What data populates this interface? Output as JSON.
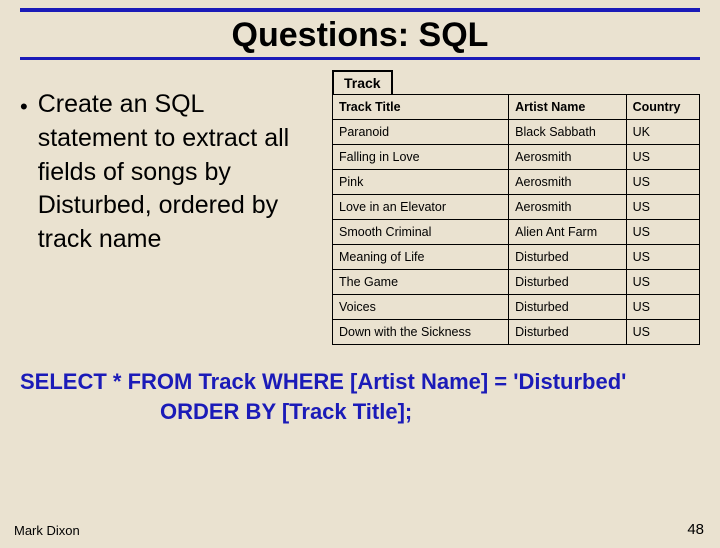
{
  "title": "Questions: SQL",
  "bullet": {
    "marker": "•",
    "text": "Create an SQL statement to extract all fields of songs by Disturbed, ordered by track name"
  },
  "table": {
    "label": "Track",
    "headers": {
      "title": "Track Title",
      "artist": "Artist Name",
      "country": "Country"
    },
    "rows": [
      {
        "title": "Paranoid",
        "artist": "Black Sabbath",
        "country": "UK"
      },
      {
        "title": "Falling in Love",
        "artist": "Aerosmith",
        "country": "US"
      },
      {
        "title": "Pink",
        "artist": "Aerosmith",
        "country": "US"
      },
      {
        "title": "Love in an Elevator",
        "artist": "Aerosmith",
        "country": "US"
      },
      {
        "title": "Smooth Criminal",
        "artist": "Alien Ant Farm",
        "country": "US"
      },
      {
        "title": "Meaning of Life",
        "artist": "Disturbed",
        "country": "US"
      },
      {
        "title": "The Game",
        "artist": "Disturbed",
        "country": "US"
      },
      {
        "title": "Voices",
        "artist": "Disturbed",
        "country": "US"
      },
      {
        "title": "Down with the Sickness",
        "artist": "Disturbed",
        "country": "US"
      }
    ]
  },
  "sql": {
    "line1": "SELECT * FROM Track WHERE [Artist Name] = 'Disturbed'",
    "line2": "ORDER BY [Track Title];"
  },
  "footer": {
    "author": "Mark Dixon",
    "page": "48"
  }
}
